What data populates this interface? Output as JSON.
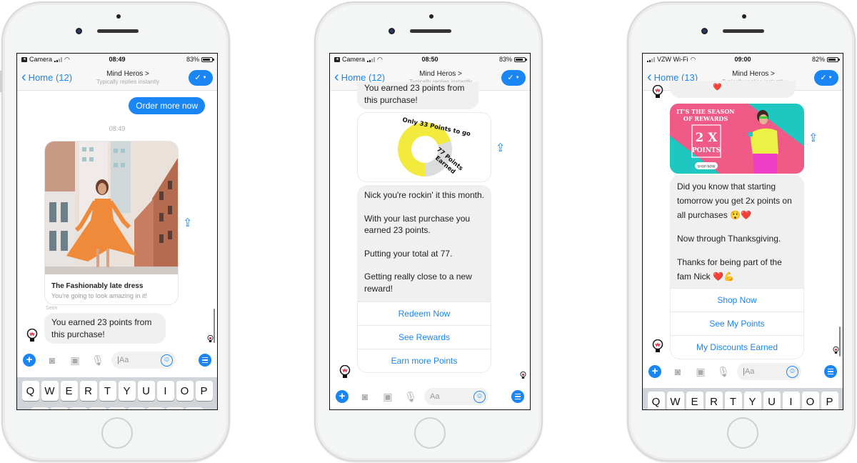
{
  "phones": [
    {
      "status": {
        "left_label": "Camera",
        "time": "08:49",
        "battery": "83%",
        "battery_level": 0.83
      },
      "nav": {
        "back_label": "Home (12)",
        "title": "Mind Heros >",
        "subtitle": "Typically replies instantly"
      },
      "messages": {
        "sent": "Order more now",
        "timestamp": "08:49",
        "card_title": "The Fashionably late dress",
        "card_subtitle": "You're going to look amazing in it!",
        "seen_label": "Seen",
        "received": "You earned 23 points from this purchase!"
      },
      "composer": {
        "placeholder": "Aa"
      },
      "keyboard": [
        "Q",
        "W",
        "E",
        "R",
        "T",
        "Y",
        "U",
        "I",
        "O",
        "P"
      ]
    },
    {
      "status": {
        "left_label": "Camera",
        "time": "08:50",
        "battery": "83%",
        "battery_level": 0.83
      },
      "nav": {
        "back_label": "Home (12)",
        "title": "Mind Heros >",
        "subtitle": "Typically replies instantly"
      },
      "messages": {
        "partial": "You earned 23 points from this purchase!",
        "chart_top_label": "Only 33 Points to go",
        "chart_side_label_1": "77 Points",
        "chart_side_label_2": "Earned",
        "body_1": "Nick you're rockin' it this month.",
        "body_2": "With your last purchase you earned 23 points.",
        "body_3": "Putting your total at 77.",
        "body_4": "Getting really close to a new reward!",
        "quick_replies": [
          "Redeem Now",
          "See Rewards",
          "Earn more Points"
        ]
      },
      "composer": {
        "placeholder": "Aa"
      }
    },
    {
      "status": {
        "left_label": "VZW Wi-Fi",
        "time": "09:00",
        "battery": "82%",
        "battery_level": 0.82
      },
      "nav": {
        "back_label": "Home (13)",
        "title": "Mind Heros >",
        "subtitle": "Typically replies instantly"
      },
      "messages": {
        "banner_line1": "IT'S THE SEASON",
        "banner_line2": "OF REWARDS",
        "banner_big": "2 X",
        "banner_points": "POINTS",
        "banner_cta": "SHOP NOW",
        "body_1": "Did you know that starting tomorrow you get 2x points on all purchases 😲❤️",
        "body_2": "Now through Thanksgiving.",
        "body_3": "Thanks for being part of the fam Nick ❤️💪",
        "quick_replies": [
          "Shop Now",
          "See My Points",
          "My Discounts Earned"
        ]
      },
      "composer": {
        "placeholder": "Aa"
      },
      "keyboard": [
        "Q",
        "W",
        "E",
        "R",
        "T",
        "Y",
        "U",
        "I",
        "O",
        "P"
      ]
    }
  ],
  "points_progress": {
    "earned": 77,
    "remaining": 33,
    "fraction_earned": 0.7
  },
  "colors": {
    "messenger_blue": "#1a86f5",
    "bubble_grey": "#f0f0f0",
    "chart_yellow": "#f3ea3e",
    "chart_grey": "#dcdcdc",
    "banner_teal": "#1ec8c0",
    "banner_pink": "#ef5a86"
  }
}
